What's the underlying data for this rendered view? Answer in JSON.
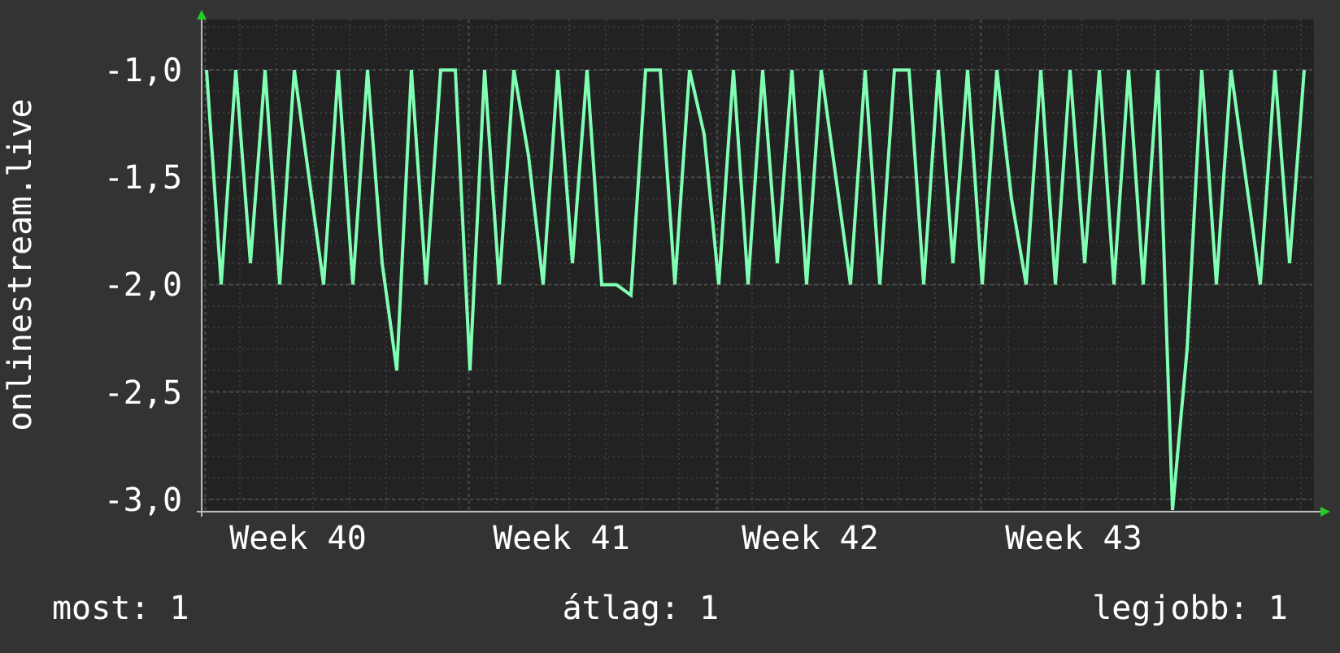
{
  "chart": {
    "chart_data": {
      "type": "line",
      "grid": true,
      "ylabel": "onlinestream.live",
      "ylim": [
        -3.05,
        -0.765
      ],
      "yticks": [
        {
          "value": -1,
          "label": "-1,0"
        },
        {
          "value": -1.5,
          "label": "-1,5"
        },
        {
          "value": -2,
          "label": "-2,0"
        },
        {
          "value": -2.5,
          "label": "-2,5"
        },
        {
          "value": -3,
          "label": "-3,0"
        }
      ],
      "categories": [
        null,
        null,
        null,
        null,
        null,
        null,
        "Week 40",
        null,
        null,
        null,
        null,
        null,
        null,
        null,
        null,
        null,
        null,
        null,
        null,
        null,
        null,
        null,
        null,
        null,
        "Week 41",
        null,
        null,
        null,
        null,
        null,
        null,
        null,
        null,
        null,
        null,
        null,
        null,
        null,
        null,
        null,
        null,
        "Week 42",
        null,
        null,
        null,
        null,
        null,
        null,
        null,
        null,
        null,
        null,
        null,
        null,
        null,
        null,
        null,
        null,
        null,
        "Week 43",
        null,
        null,
        null,
        null,
        null,
        null,
        null,
        null,
        null,
        null,
        null,
        null,
        null,
        null,
        null,
        null
      ],
      "series": [
        {
          "color": "#80ffb4",
          "values": [
            -1,
            -2,
            -1,
            -1.9,
            -1,
            -2,
            -1,
            -1.5,
            -2,
            -1,
            -2,
            -1,
            -1.9,
            -2.4,
            -1,
            -2,
            -1,
            -1,
            -2.4,
            -1,
            -2,
            -1,
            -1.4,
            -2,
            -1,
            -1.9,
            -1,
            -2,
            -2,
            -2.05,
            -1,
            -1,
            -2,
            -1,
            -1.3,
            -2,
            -1,
            -2,
            -1,
            -1.9,
            -1,
            -2,
            -1,
            -1.5,
            -2,
            -1,
            -2,
            -1,
            -1,
            -2,
            -1,
            -1.9,
            -1,
            -2,
            -1,
            -1.6,
            -2,
            -1,
            -2,
            -1,
            -1.9,
            -1,
            -2,
            -1,
            -2,
            -1,
            -3.05,
            -2.3,
            -1,
            -2,
            -1,
            -1.5,
            -2,
            -1,
            -1.9,
            -1
          ]
        }
      ]
    }
  },
  "stats": [
    {
      "text": "most: 1"
    },
    {
      "text": "átlag: 1"
    },
    {
      "text": "legjobb: 1"
    }
  ]
}
